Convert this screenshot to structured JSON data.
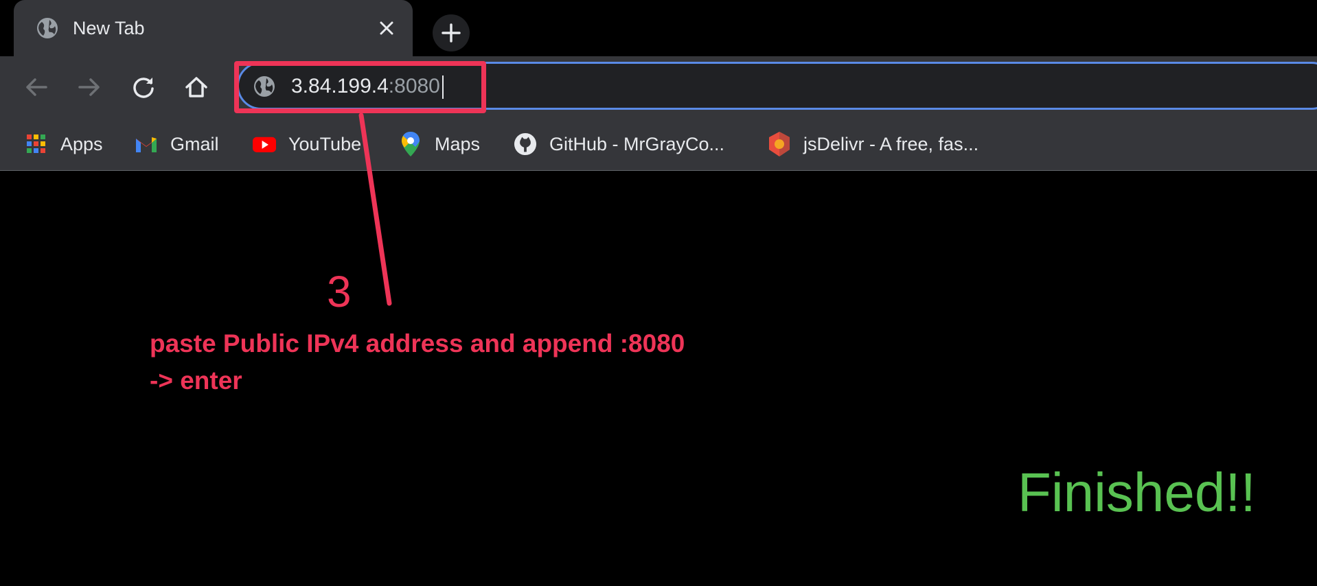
{
  "tab": {
    "title": "New Tab",
    "close_symbol": "✕",
    "new_tab_symbol": "+"
  },
  "toolbar": {
    "back_icon": "back-arrow-icon",
    "forward_icon": "forward-arrow-icon",
    "reload_icon": "reload-icon",
    "home_icon": "home-icon"
  },
  "omnibox": {
    "host": "3.84.199.4",
    "port": ":8080"
  },
  "bookmarks": [
    {
      "label": "Apps",
      "icon": "apps-grid-icon"
    },
    {
      "label": "Gmail",
      "icon": "gmail-icon"
    },
    {
      "label": "YouTube",
      "icon": "youtube-icon"
    },
    {
      "label": "Maps",
      "icon": "maps-pin-icon"
    },
    {
      "label": "GitHub - MrGrayCo...",
      "icon": "github-icon"
    },
    {
      "label": "jsDelivr - A free, fas...",
      "icon": "jsdelivr-icon"
    }
  ],
  "annotation": {
    "step": "3",
    "line1": "paste Public IPv4 address and append :8080",
    "line2": "-> enter",
    "color": "#ee3457"
  },
  "finished_text": "Finished!!",
  "colors": {
    "finished": "#59c252",
    "omnibox_focus": "#5a8ae6"
  }
}
